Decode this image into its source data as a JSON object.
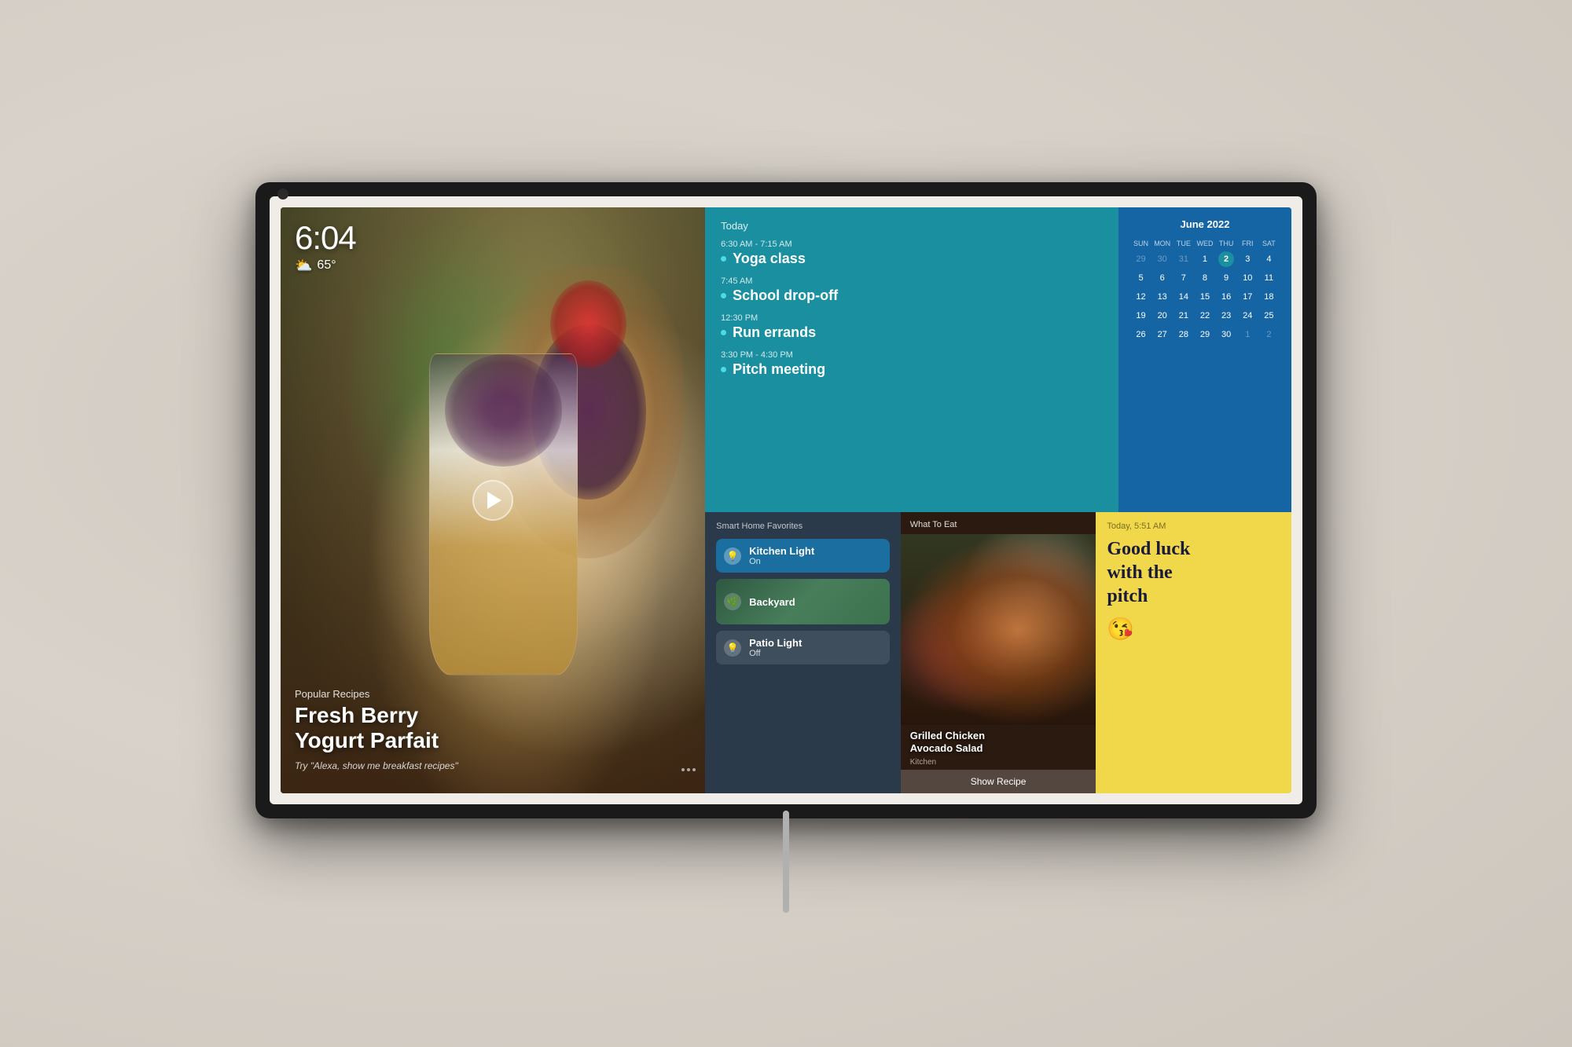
{
  "device": {
    "camera_label": "camera"
  },
  "time": {
    "display": "6:04",
    "weather_icon": "⛅",
    "temperature": "65°"
  },
  "recipe": {
    "category": "Popular Recipes",
    "title": "Fresh Berry\nYogurt Parfait",
    "hint": "Try \"Alexa, show me breakfast recipes\""
  },
  "calendar": {
    "today_label": "Today",
    "month_label": "June 2022",
    "days_of_week": [
      "SUN",
      "MON",
      "TUE",
      "WED",
      "THU",
      "FRI",
      "SAT"
    ],
    "weeks": [
      [
        {
          "num": "29",
          "other": true
        },
        {
          "num": "30",
          "other": true
        },
        {
          "num": "31",
          "other": true
        },
        {
          "num": "1",
          "other": false
        },
        {
          "num": "2",
          "other": false,
          "today": true
        },
        {
          "num": "3",
          "other": false
        },
        {
          "num": "4",
          "other": false
        }
      ],
      [
        {
          "num": "5"
        },
        {
          "num": "6"
        },
        {
          "num": "7"
        },
        {
          "num": "8"
        },
        {
          "num": "9"
        },
        {
          "num": "10"
        },
        {
          "num": "11"
        }
      ],
      [
        {
          "num": "12"
        },
        {
          "num": "13"
        },
        {
          "num": "14"
        },
        {
          "num": "15"
        },
        {
          "num": "16"
        },
        {
          "num": "17"
        },
        {
          "num": "18"
        }
      ],
      [
        {
          "num": "19"
        },
        {
          "num": "20"
        },
        {
          "num": "21"
        },
        {
          "num": "22"
        },
        {
          "num": "23"
        },
        {
          "num": "24"
        },
        {
          "num": "25"
        }
      ],
      [
        {
          "num": "26"
        },
        {
          "num": "27"
        },
        {
          "num": "28"
        },
        {
          "num": "29"
        },
        {
          "num": "30"
        },
        {
          "num": "1",
          "other": true
        },
        {
          "num": "2",
          "other": true
        }
      ]
    ]
  },
  "events": {
    "label": "Today",
    "items": [
      {
        "time": "6:30 AM - 7:15 AM",
        "name": "Yoga class"
      },
      {
        "time": "7:45 AM",
        "name": "School drop-off"
      },
      {
        "time": "12:30 PM",
        "name": "Run errands"
      },
      {
        "time": "3:30 PM - 4:30 PM",
        "name": "Pitch meeting"
      }
    ]
  },
  "smart_home": {
    "title": "Smart Home Favorites",
    "devices": [
      {
        "name": "Kitchen Light",
        "status": "On",
        "active": true,
        "icon": "💡"
      },
      {
        "name": "Backyard",
        "status": "",
        "active": false,
        "icon": "🌿",
        "is_backyard": true
      },
      {
        "name": "Patio Light",
        "status": "Off",
        "active": false,
        "icon": "💡"
      }
    ]
  },
  "what_to_eat": {
    "label": "What To Eat",
    "dish_name": "Grilled Chicken\nAvocado Salad",
    "source": "Kitchen",
    "show_recipe_label": "Show Recipe"
  },
  "sticky_note": {
    "timestamp": "Today, 5:51 AM",
    "text": "Good luck\nwith the\npitch",
    "emoji": "😘"
  }
}
